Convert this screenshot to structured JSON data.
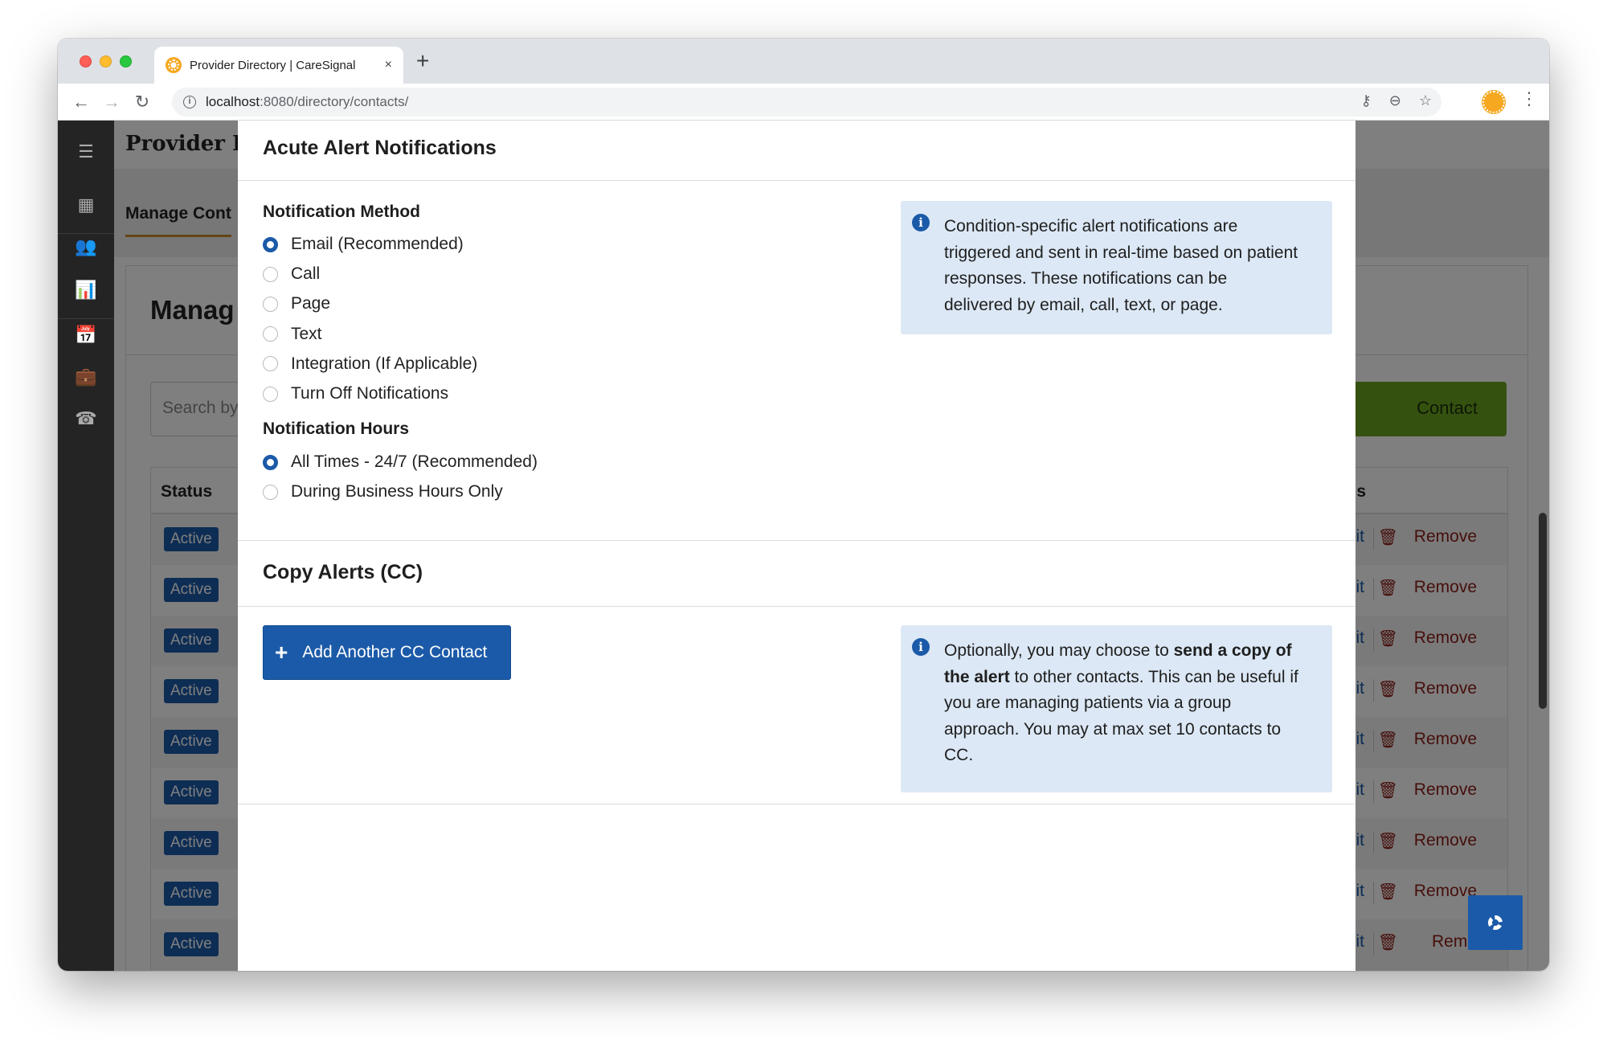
{
  "browser": {
    "tab_title": "Provider Directory | CareSignal",
    "close_glyph": "×",
    "newtab_glyph": "+",
    "url_host": "localhost",
    "url_path": ":8080/directory/contacts/"
  },
  "app": {
    "title": "Provider I",
    "subnav_tab": "Manage Cont",
    "card_title": "Manag",
    "search_placeholder": "Search by",
    "add_contact_label": "Contact",
    "table": {
      "status_header": "Status",
      "actions_header": "s",
      "rows": [
        {
          "status": "Active",
          "edit": "dit",
          "remove": "Remove"
        },
        {
          "status": "Active",
          "edit": "dit",
          "remove": "Remove"
        },
        {
          "status": "Active",
          "edit": "dit",
          "remove": "Remove"
        },
        {
          "status": "Active",
          "edit": "dit",
          "remove": "Remove"
        },
        {
          "status": "Active",
          "edit": "dit",
          "remove": "Remove"
        },
        {
          "status": "Active",
          "edit": "dit",
          "remove": "Remove"
        },
        {
          "status": "Active",
          "edit": "dit",
          "remove": "Remove"
        },
        {
          "status": "Active",
          "edit": "dit",
          "remove": "Remove"
        },
        {
          "status": "Active",
          "edit": "dit",
          "remove": "Remo"
        }
      ]
    }
  },
  "modal": {
    "title": "Acute Alert Notifications",
    "method_label": "Notification Method",
    "methods": [
      {
        "label": "Email (Recommended)",
        "selected": true
      },
      {
        "label": "Call",
        "selected": false
      },
      {
        "label": "Page",
        "selected": false
      },
      {
        "label": "Text",
        "selected": false
      },
      {
        "label": "Integration (If Applicable)",
        "selected": false
      },
      {
        "label": "Turn Off Notifications",
        "selected": false
      }
    ],
    "hours_label": "Notification Hours",
    "hours": [
      {
        "label": "All Times - 24/7 (Recommended)",
        "selected": true
      },
      {
        "label": "During Business Hours Only",
        "selected": false
      }
    ],
    "info1": "Condition-specific alert notifications are triggered and sent in real-time based on patient responses. These notifications can be delivered by email, call, text, or page.",
    "cc_title": "Copy Alerts (CC)",
    "cc_button": "Add Another CC Contact",
    "info2_pre": "Optionally, you may choose to ",
    "info2_bold": "send a copy of the alert",
    "info2_post": " to other contacts. This can be useful if you are managing patients via a group approach. You may at max set 10 contacts to CC."
  },
  "colors": {
    "accent": "#1b5aa8",
    "info_bg": "#dce8f5",
    "remove": "#8b1d17",
    "add_contact": "#6aa221",
    "subnav_underline": "#c88a2c"
  }
}
